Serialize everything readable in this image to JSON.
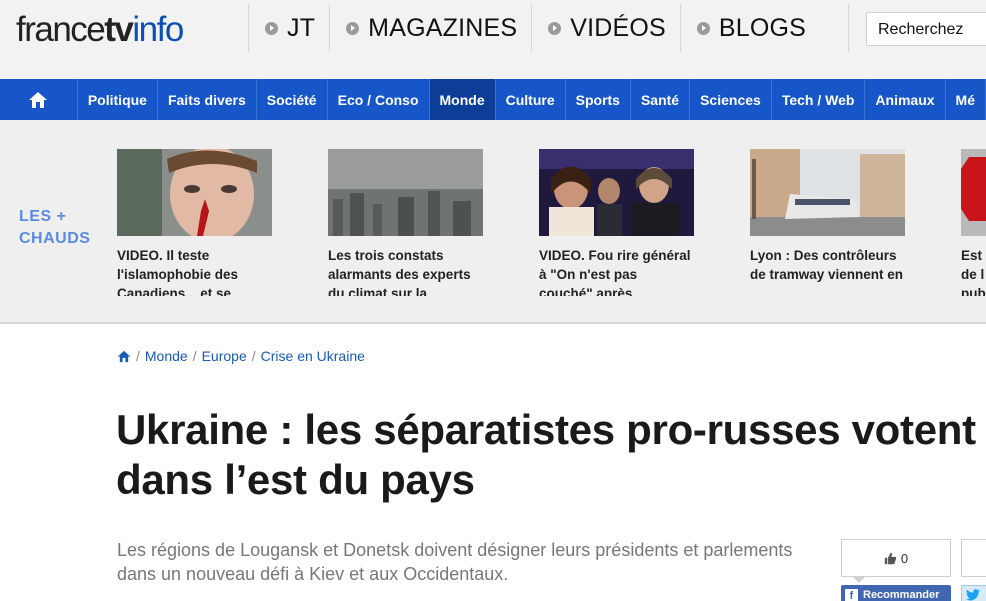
{
  "logo": {
    "part1": "france",
    "part2": "tv",
    "part3": "info"
  },
  "topnav": [
    {
      "label": "JT"
    },
    {
      "label": "MAGAZINES"
    },
    {
      "label": "VIDÉOS"
    },
    {
      "label": "BLOGS"
    }
  ],
  "search": {
    "placeholder": "Recherchez"
  },
  "nav": {
    "items": [
      {
        "label": "Politique"
      },
      {
        "label": "Faits divers"
      },
      {
        "label": "Société"
      },
      {
        "label": "Eco / Conso"
      },
      {
        "label": "Monde"
      },
      {
        "label": "Culture"
      },
      {
        "label": "Sports"
      },
      {
        "label": "Santé"
      },
      {
        "label": "Sciences"
      },
      {
        "label": "Tech / Web"
      },
      {
        "label": "Animaux"
      },
      {
        "label": "Mé"
      }
    ],
    "active": "Monde"
  },
  "hot": {
    "label_line1": "LES +",
    "label_line2": "CHAUDS",
    "cards": [
      {
        "title": "VIDEO. Il teste l'islamophobie des Canadiens... et se"
      },
      {
        "title": "Les trois constats alarmants des experts du climat sur la"
      },
      {
        "title": "VIDEO. Fou rire général à \"On n'est pas couché\" après"
      },
      {
        "title": "Lyon : Des contrôleurs de tramway viennent en"
      },
      {
        "title": "Est de l pub"
      }
    ]
  },
  "breadcrumb": {
    "items": [
      "Monde",
      "Europe",
      "Crise en Ukraine"
    ]
  },
  "article": {
    "headline": "Ukraine : les séparatistes pro-russes votent dans l’est du pays",
    "lede": "Les régions de Lougansk et Donetsk doivent désigner leurs présidents et parlements dans un nouveau défi à Kiev et aux Occidentaux."
  },
  "social": {
    "like_count": "0",
    "recommend_label": "Recommander"
  },
  "colors": {
    "brand_blue": "#1656c9",
    "active_nav": "#0d3e97",
    "hot_label": "#5b8be0",
    "link": "#1a5ab8"
  }
}
